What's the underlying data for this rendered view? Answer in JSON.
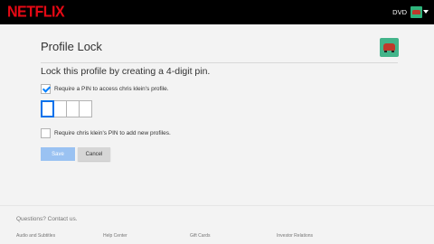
{
  "header": {
    "logo": "NETFLIX",
    "profile_name": "DVD",
    "brand_color": "#e50914"
  },
  "page": {
    "title": "Profile Lock",
    "subtitle": "Lock this profile by creating a 4-digit pin.",
    "require_pin_label": "Require a PIN to access chris klein's profile.",
    "require_pin_checked": true,
    "pin_digits": [
      "",
      "",
      "",
      ""
    ],
    "require_add_profiles_label": "Require chris klein's PIN to add new profiles.",
    "require_add_profiles_checked": false,
    "save_label": "Save",
    "cancel_label": "Cancel"
  },
  "footer": {
    "contact": "Questions? Contact us.",
    "links": [
      "Audio and Subtitles",
      "Help Center",
      "Gift Cards",
      "Investor Relations"
    ]
  }
}
